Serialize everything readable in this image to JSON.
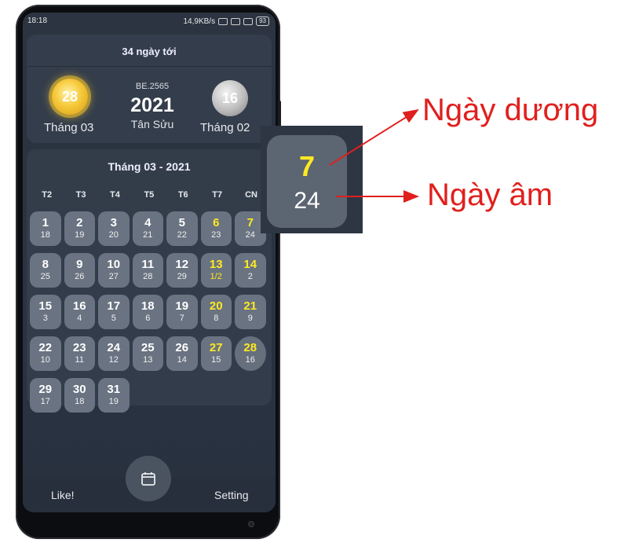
{
  "status_bar": {
    "time": "18:18",
    "speed": "14,9KB/s",
    "battery": "93"
  },
  "top_card": {
    "days_until": "34 ngày tới",
    "solar_day": "28",
    "solar_month_label": "Tháng 03",
    "buddhist_era": "BE.2565",
    "year": "2021",
    "can_chi": "Tân Sửu",
    "lunar_day": "16",
    "lunar_month_label": "Tháng 02"
  },
  "calendar": {
    "title": "Tháng 03 - 2021",
    "weekdays": [
      "T2",
      "T3",
      "T4",
      "T5",
      "T6",
      "T7",
      "CN"
    ],
    "days": [
      {
        "solar": "1",
        "lunar": "18"
      },
      {
        "solar": "2",
        "lunar": "19"
      },
      {
        "solar": "3",
        "lunar": "20"
      },
      {
        "solar": "4",
        "lunar": "21"
      },
      {
        "solar": "5",
        "lunar": "22"
      },
      {
        "solar": "6",
        "lunar": "23"
      },
      {
        "solar": "7",
        "lunar": "24"
      },
      {
        "solar": "8",
        "lunar": "25"
      },
      {
        "solar": "9",
        "lunar": "26"
      },
      {
        "solar": "10",
        "lunar": "27"
      },
      {
        "solar": "11",
        "lunar": "28"
      },
      {
        "solar": "12",
        "lunar": "29"
      },
      {
        "solar": "13",
        "lunar": "1/2"
      },
      {
        "solar": "14",
        "lunar": "2"
      },
      {
        "solar": "15",
        "lunar": "3"
      },
      {
        "solar": "16",
        "lunar": "4"
      },
      {
        "solar": "17",
        "lunar": "5"
      },
      {
        "solar": "18",
        "lunar": "6"
      },
      {
        "solar": "19",
        "lunar": "7"
      },
      {
        "solar": "20",
        "lunar": "8"
      },
      {
        "solar": "21",
        "lunar": "9"
      },
      {
        "solar": "22",
        "lunar": "10"
      },
      {
        "solar": "23",
        "lunar": "11"
      },
      {
        "solar": "24",
        "lunar": "12"
      },
      {
        "solar": "25",
        "lunar": "13"
      },
      {
        "solar": "26",
        "lunar": "14"
      },
      {
        "solar": "27",
        "lunar": "15"
      },
      {
        "solar": "28",
        "lunar": "16"
      },
      {
        "solar": "29",
        "lunar": "17"
      },
      {
        "solar": "30",
        "lunar": "18"
      },
      {
        "solar": "31",
        "lunar": "19"
      }
    ]
  },
  "bottom_nav": {
    "like_label": "Like!",
    "setting_label": "Setting",
    "center_icon": "calendar-icon"
  },
  "zoom": {
    "solar": "7",
    "lunar": "24"
  },
  "annotations": {
    "solar_label": "Ngày dương",
    "lunar_label": "Ngày âm"
  },
  "colors": {
    "weekend_yellow": "#ffe922",
    "annotation_red": "#e0201e",
    "cell_bg": "#6a7381"
  }
}
